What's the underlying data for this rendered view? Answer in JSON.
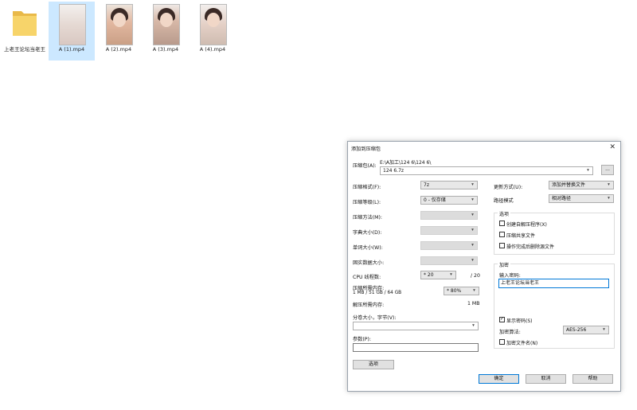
{
  "explorer": {
    "files": [
      {
        "name": "上老王论坛当老王",
        "kind": "folder",
        "selected": false
      },
      {
        "name": "A (1).mp4",
        "kind": "video",
        "selected": true
      },
      {
        "name": "A (2).mp4",
        "kind": "video",
        "selected": false
      },
      {
        "name": "A (3).mp4",
        "kind": "video",
        "selected": false
      },
      {
        "name": "A (4).mp4",
        "kind": "video",
        "selected": false
      }
    ]
  },
  "dialog": {
    "title": "添加到压缩包",
    "archive_label": "压缩包(A):",
    "archive_path": "E:\\A加工\\124 6\\124 6\\",
    "archive_name": "124 6.7z",
    "browse_label": "...",
    "left": {
      "format_label": "压缩格式(F):",
      "format_value": "7z",
      "level_label": "压缩等级(L):",
      "level_value": "0 - 仅存储",
      "method_label": "压缩方法(M):",
      "dict_label": "字典大小(D):",
      "word_label": "单词大小(W):",
      "solid_label": "固实数据大小:",
      "cpu_label": "CPU 线程数:",
      "cpu_value": "* 20",
      "cpu_total": "/ 20",
      "mem_label": "压缩所需内存:",
      "mem_detail": "1 MB / 51 GB / 64 GB",
      "mem_pct": "* 80%",
      "decomp_label": "解压所需内存:",
      "decomp_value": "1 MB",
      "split_label": "分卷大小，字节(V):",
      "params_label": "参数(P):",
      "options_button": "选项"
    },
    "right": {
      "update_label": "更新方式(U):",
      "update_value": "添加并替换文件",
      "path_label": "路径模式",
      "path_value": "相对路径",
      "options_group": "选项",
      "opt_sfx": "创建自解压程序(X)",
      "opt_shared": "压缩共享文件",
      "opt_delete": "操作完成后删除源文件",
      "enc_group": "加密",
      "pw_label": "输入密码:",
      "pw_value": "上老王论坛当老王",
      "show_pw": "显示密码(S)",
      "enc_method_label": "加密算法:",
      "enc_method_value": "AES-256",
      "enc_names": "加密文件名(N)"
    },
    "buttons": {
      "ok": "确定",
      "cancel": "取消",
      "help": "帮助"
    },
    "checked": {
      "sfx": false,
      "shared": false,
      "delete": false,
      "show_pw": true,
      "enc_names": false
    }
  }
}
